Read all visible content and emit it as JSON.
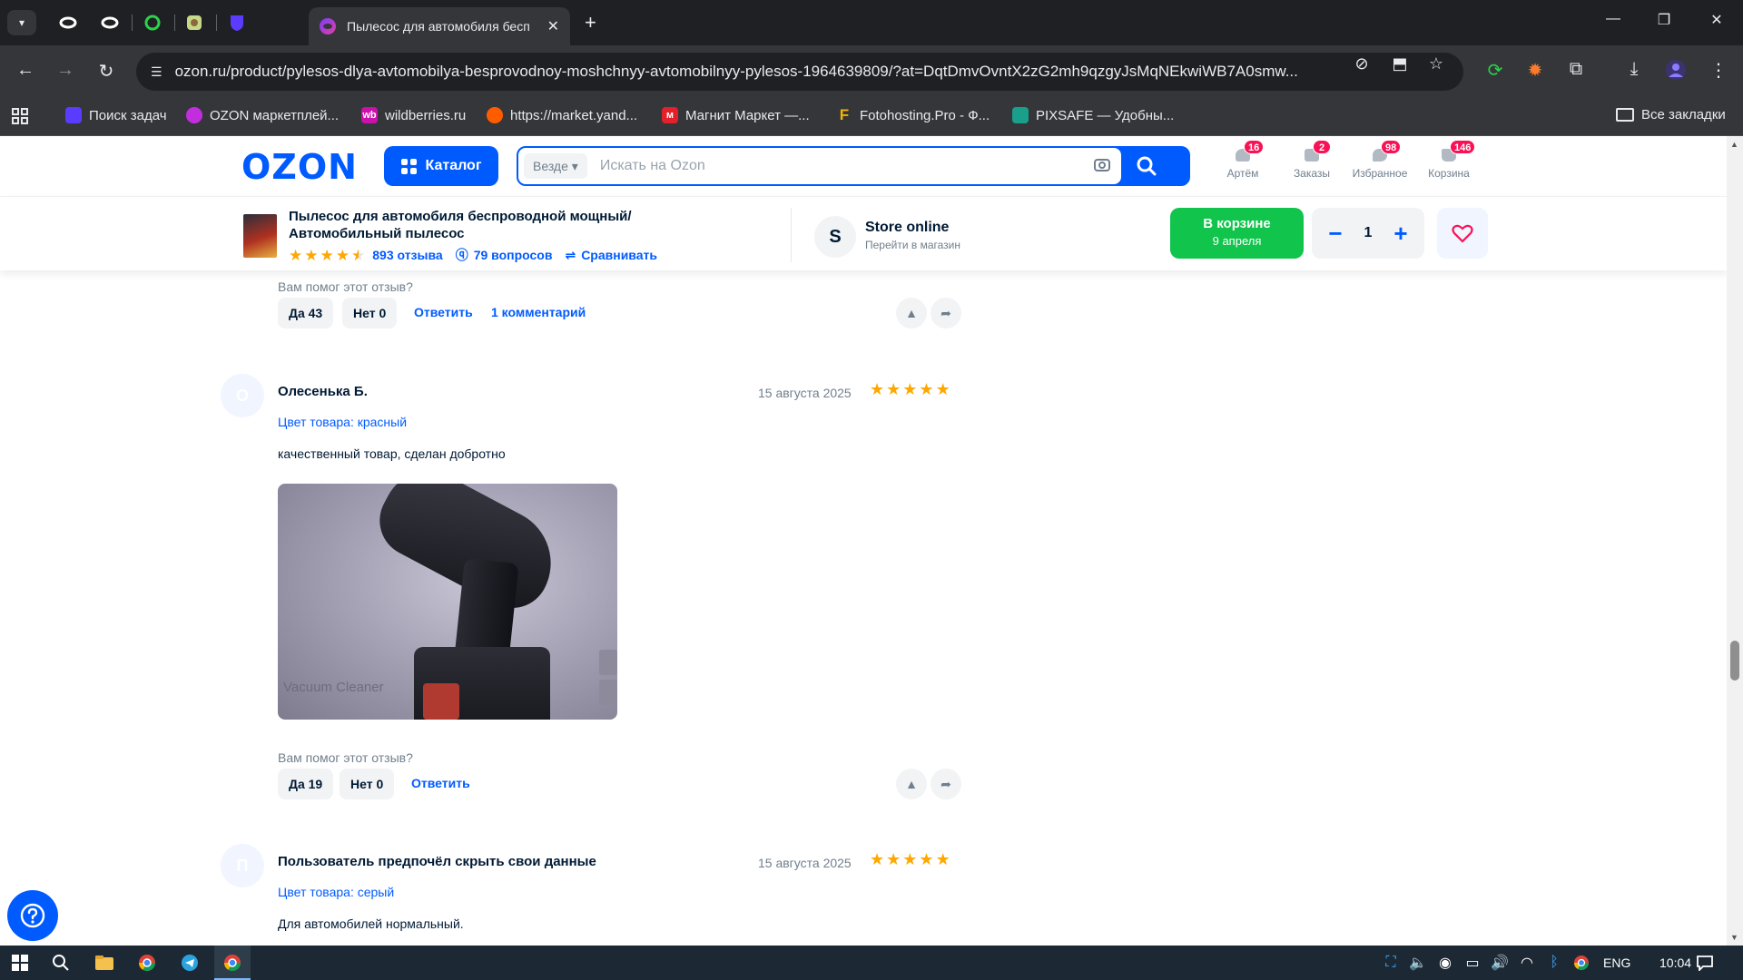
{
  "browser": {
    "active_tab_title": "Пылесос для автомобиля бесп",
    "url": "ozon.ru/product/pylesos-dlya-avtomobilya-besprovodnoy-moshchnyy-avtomobilnyy-pylesos-1964639809/?at=DqtDmvOvntX2zG2mh9qzgyJsMqNEkwiWB7A0smw...",
    "new_tab_symbol": "+",
    "close_symbol": "✕",
    "bookmarks": [
      {
        "label": "Поиск задач",
        "icon": "shield-icon",
        "color": "#5b3cff"
      },
      {
        "label": "OZON маркетплей...",
        "icon": "ozon-icon",
        "color": "#c22ede"
      },
      {
        "label": "wildberries.ru",
        "icon": "wb-icon",
        "color": "#cb11ab"
      },
      {
        "label": "https://market.yand...",
        "icon": "yandex-market-icon",
        "color": "#ff5c00"
      },
      {
        "label": "Магнит Маркет —...",
        "icon": "magnit-icon",
        "color": "#e4202a"
      },
      {
        "label": "Fotohosting.Pro - Ф...",
        "icon": "fotohosting-icon",
        "color": "#f5b400"
      },
      {
        "label": "PIXSAFE — Удобны...",
        "icon": "pixsafe-icon",
        "color": "#1aa08a"
      }
    ],
    "all_bookmarks_label": "Все закладки"
  },
  "header": {
    "logo": "OZON",
    "catalog_label": "Каталог",
    "search_scope": "Везде",
    "search_placeholder": "Искать на Ozon",
    "items": [
      {
        "label": "Артём",
        "badge": "16"
      },
      {
        "label": "Заказы",
        "badge": "2"
      },
      {
        "label": "Избранное",
        "badge": "98"
      },
      {
        "label": "Корзина",
        "badge": "146"
      }
    ]
  },
  "product": {
    "title": "Пылесос для автомобиля беспроводной мощный/ Автомобильный пылесос",
    "rating_stars": 4.5,
    "reviews_link": "893 отзыва",
    "questions_link": "79 вопросов",
    "compare_link": "Сравнивать",
    "store_initial": "S",
    "store_name": "Store online",
    "store_sub": "Перейти в магазин",
    "cart_line1": "В корзине",
    "cart_line2": "9 апреля",
    "quantity": "1",
    "minus": "−",
    "plus": "+"
  },
  "reviews": {
    "helpful_question": "Вам помог этот отзыв?",
    "reply_label": "Ответить",
    "prev": {
      "yes": "Да 43",
      "no": "Нет 0",
      "comments": "1 комментарий"
    },
    "items": [
      {
        "avatar_letter": "О",
        "author": "Олесенька Б.",
        "date": "15 августа 2025",
        "stars": 5,
        "variant": "Цвет товара: красный",
        "text": "качественный товар, сделан добротно",
        "photo_caption": "Vacuum Cleaner",
        "yes": "Да 19",
        "no": "Нет 0"
      },
      {
        "avatar_letter": "П",
        "author": "Пользователь предпочёл скрыть свои данные",
        "date": "15 августа 2025",
        "stars": 5,
        "variant": "Цвет товара: серый",
        "text": "Для автомобилей нормальный."
      }
    ]
  },
  "taskbar": {
    "language": "ENG",
    "time": "10:04"
  },
  "colors": {
    "ozon_blue": "#005bff",
    "cart_green": "#10c44c",
    "badge_pink": "#f91155",
    "star": "#ffa800"
  }
}
